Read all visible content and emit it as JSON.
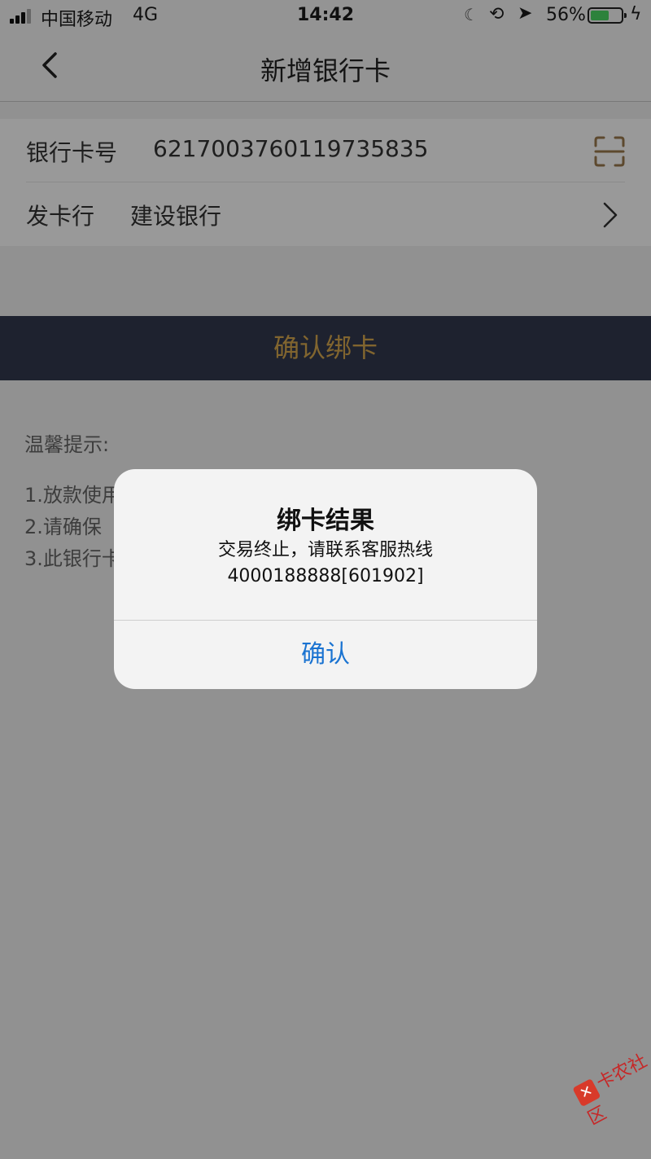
{
  "status_bar": {
    "carrier": "中国移动",
    "network": "4G",
    "time": "14:42",
    "battery_percent": "56%",
    "icons": [
      "signal-icon",
      "moon-icon",
      "rotation-lock-icon",
      "location-icon",
      "battery-icon",
      "charging-icon"
    ]
  },
  "nav": {
    "title": "新增银行卡",
    "back_icon": "chevron-left-icon"
  },
  "form": {
    "card_number_label": "银行卡号",
    "card_number_value": "6217003760119735835",
    "issuer_label": "发卡行",
    "issuer_value": "建设银行",
    "scan_icon": "scan-icon",
    "chevron_icon": "chevron-right-icon"
  },
  "confirm_button": {
    "label": "确认绑卡"
  },
  "tips": {
    "title": "温馨提示:",
    "items": [
      "1.放款使用",
      "2.请确保",
      "3.此银行卡"
    ]
  },
  "alert": {
    "title": "绑卡结果",
    "message_line1": "交易终止，请联系客服热线",
    "message_line2": "4000188888[601902]",
    "button_label": "确认"
  },
  "watermark": {
    "text": "卡农社区"
  },
  "colors": {
    "accent_gold": "#d8a84f",
    "button_dark": "#333a4f",
    "alert_blue": "#1a73d1",
    "battery_green": "#4cd964",
    "watermark_red": "#c62828"
  }
}
